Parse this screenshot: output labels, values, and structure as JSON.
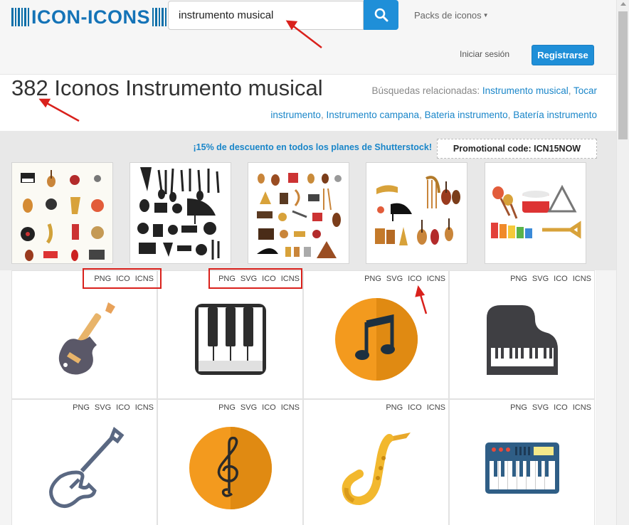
{
  "header": {
    "logo_text": "ICON-ICONS",
    "search_value": "instrumento musical",
    "packs_label": "Packs de iconos",
    "login_label": "Iniciar sesión",
    "register_label": "Registrarse"
  },
  "results": {
    "title": "382 Iconos Instrumento musical",
    "related_label": "Búsquedas relacionadas:",
    "related": [
      "Instrumento musical",
      "Tocar instrumento",
      "Instrumento campana",
      "Bateria instrumento",
      "Batería instrumento"
    ]
  },
  "promo": {
    "text": "¡15% de descuento en todos los planes de Shutterstock!",
    "code": "Promotional code: ICN15NOW"
  },
  "icons": [
    {
      "name": "electric-guitar-icon",
      "formats": [
        "PNG",
        "ICO",
        "ICNS"
      ]
    },
    {
      "name": "piano-keys-icon",
      "formats": [
        "PNG",
        "SVG",
        "ICO",
        "ICNS"
      ]
    },
    {
      "name": "music-note-icon",
      "formats": [
        "PNG",
        "SVG",
        "ICO",
        "ICNS"
      ]
    },
    {
      "name": "grand-piano-icon",
      "formats": [
        "PNG",
        "SVG",
        "ICO",
        "ICNS"
      ]
    },
    {
      "name": "bass-guitar-icon",
      "formats": [
        "PNG",
        "SVG",
        "ICO",
        "ICNS"
      ]
    },
    {
      "name": "treble-clef-icon",
      "formats": [
        "PNG",
        "SVG",
        "ICO",
        "ICNS"
      ]
    },
    {
      "name": "saxophone-icon",
      "formats": [
        "PNG",
        "ICO",
        "ICNS"
      ]
    },
    {
      "name": "synthesizer-icon",
      "formats": [
        "PNG",
        "SVG",
        "ICO",
        "ICNS"
      ]
    }
  ],
  "colors": {
    "brand": "#1473b7",
    "button": "#1f8fd8",
    "link": "#1a86c9",
    "annotation": "#d9211c"
  }
}
